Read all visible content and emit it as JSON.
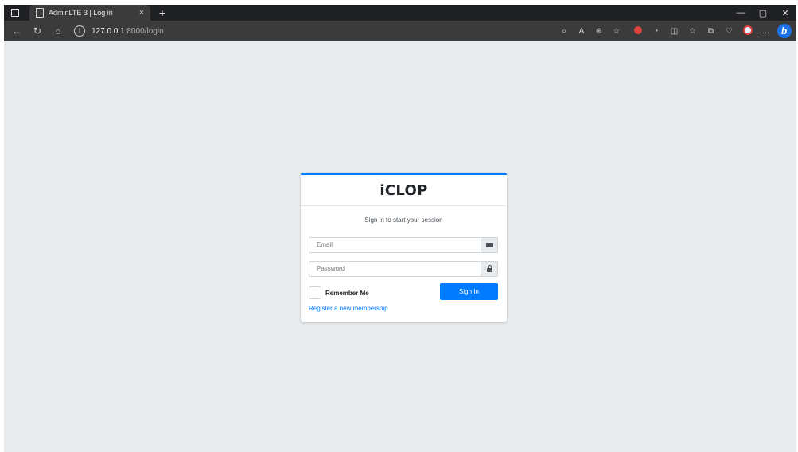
{
  "browser": {
    "tab_title": "AdminLTE 3 | Log in",
    "tab_close": "×",
    "new_tab": "+",
    "url_host": "127.0.0.1",
    "url_path": ":8000/login",
    "window_controls": {
      "minimize": "—",
      "restore": "▢",
      "close": "✕"
    }
  },
  "login": {
    "brand": "iCLOP",
    "message": "Sign in to start your session",
    "email_placeholder": "Email",
    "password_placeholder": "Password",
    "remember_label": "Remember Me",
    "signin_label": "Sign In",
    "register_link": "Register a new membership"
  },
  "colors": {
    "primary": "#007bff",
    "page_background": "#e9ecef",
    "browser_chrome": "#3b3b3b"
  }
}
